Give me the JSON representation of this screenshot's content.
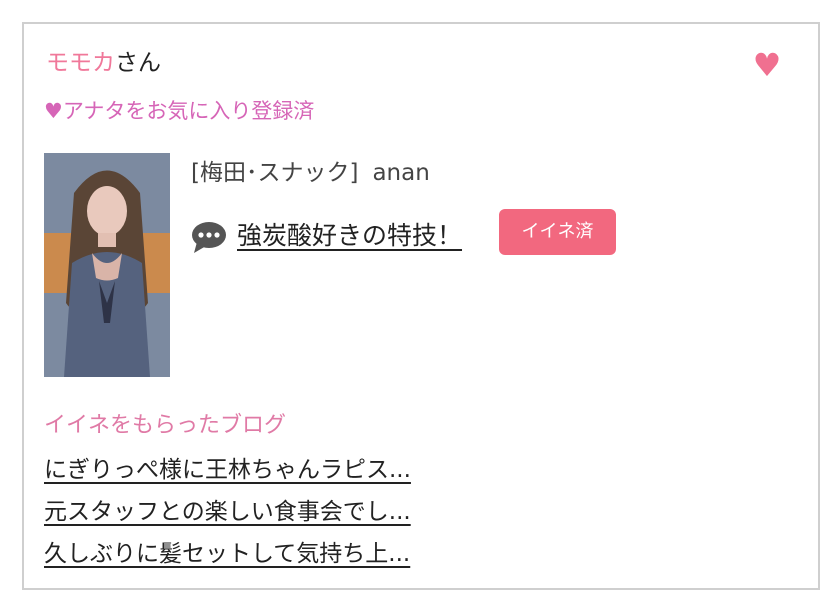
{
  "user": {
    "name": "モモカ",
    "suffix": "さん"
  },
  "favorite": {
    "heart_icon": "heart-icon",
    "status": "♥アナタをお気に入り登録済",
    "accent": "#f07090"
  },
  "post": {
    "shop": "[梅田･スナック]",
    "cast_name": "anan",
    "comment_icon": "speech-bubble-icon",
    "title": "強炭酸好きの特技！",
    "badge": "イイネ済",
    "badge_color": "#f2687f"
  },
  "blogs": {
    "heading": "イイネをもらったブログ",
    "items": [
      {
        "title": "にぎりっぺ様に王林ちゃんラピス..."
      },
      {
        "title": "元スタッフとの楽しい食事会でし..."
      },
      {
        "title": "久しぶりに髪セットして気持ち上..."
      }
    ]
  }
}
